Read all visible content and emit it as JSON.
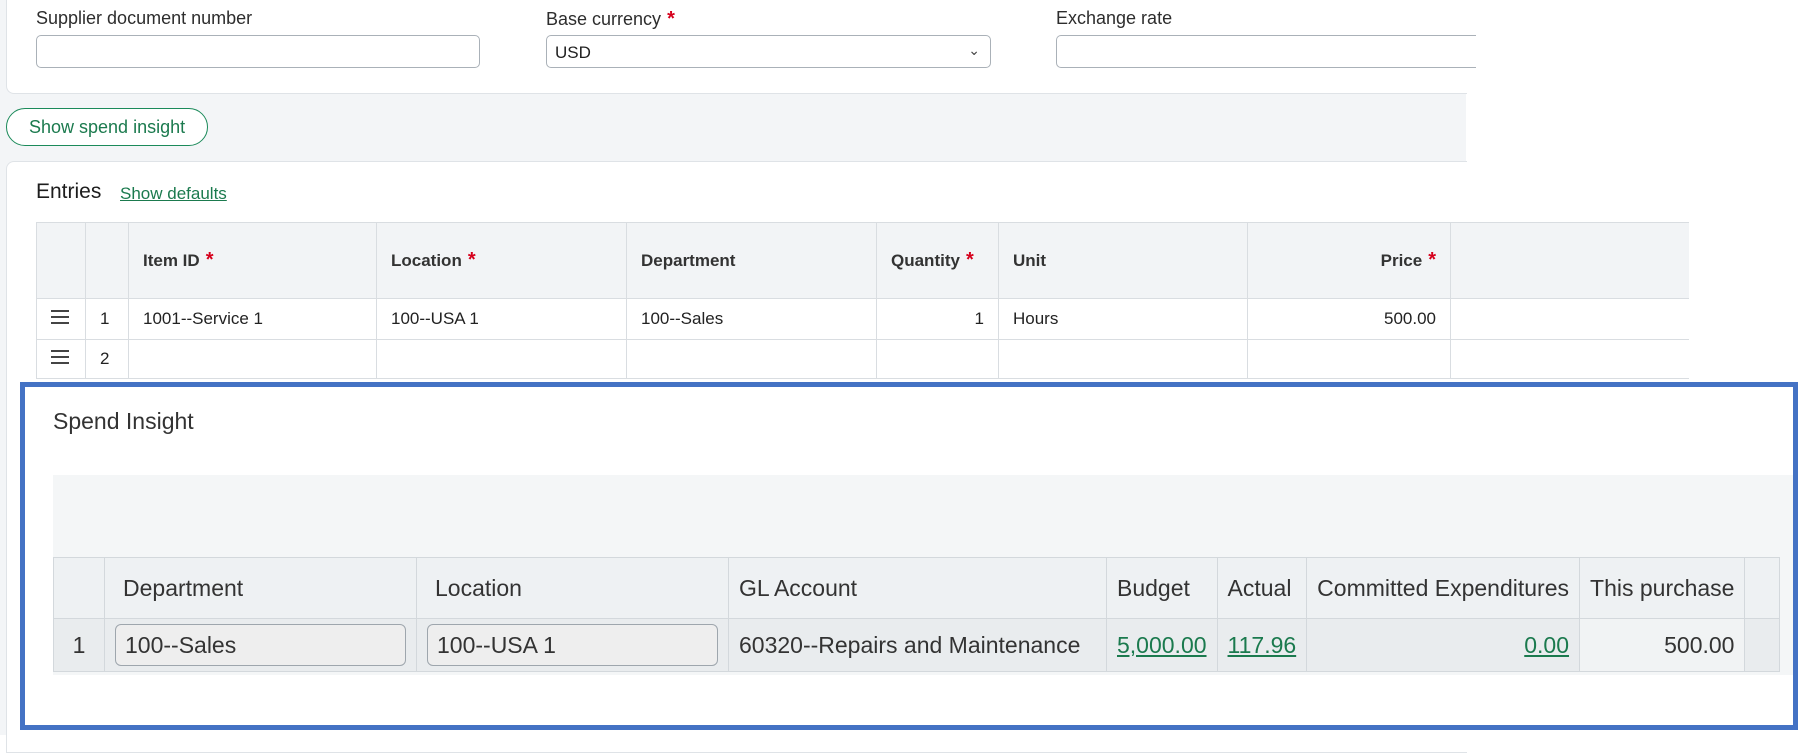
{
  "header_fields": {
    "supplier_doc_label": "Supplier document number",
    "supplier_doc_value": "",
    "base_currency_label": "Base currency",
    "base_currency_value": "USD",
    "exchange_rate_label": "Exchange rate",
    "exchange_rate_value": "",
    "required_mark": "*"
  },
  "spend_button_label": "Show spend insight",
  "entries": {
    "title": "Entries",
    "defaults_link": "Show defaults",
    "columns": [
      "Item ID",
      "Location",
      "Department",
      "Quantity",
      "Unit",
      "Price"
    ],
    "rows": [
      {
        "num": "1",
        "item_id": "1001--Service 1",
        "location": "100--USA 1",
        "department": "100--Sales",
        "quantity": "1",
        "unit": "Hours",
        "price": "500.00"
      },
      {
        "num": "2",
        "item_id": "",
        "location": "",
        "department": "",
        "quantity": "",
        "unit": "",
        "price": ""
      }
    ]
  },
  "spend_insight": {
    "title": "Spend Insight",
    "columns": [
      "Department",
      "Location",
      "GL Account",
      "Budget",
      "Actual",
      "Committed Expenditures",
      "This purchase"
    ],
    "row": {
      "num": "1",
      "department": "100--Sales",
      "location": "100--USA 1",
      "gl_account": "60320--Repairs and Maintenance",
      "budget": "5,000.00",
      "actual": "117.96",
      "committed": "0.00",
      "this_purchase": "500.00"
    }
  },
  "colors": {
    "accent_green": "#1b7a4e",
    "required_red": "#d6001c",
    "highlight_blue": "#4472c4"
  }
}
